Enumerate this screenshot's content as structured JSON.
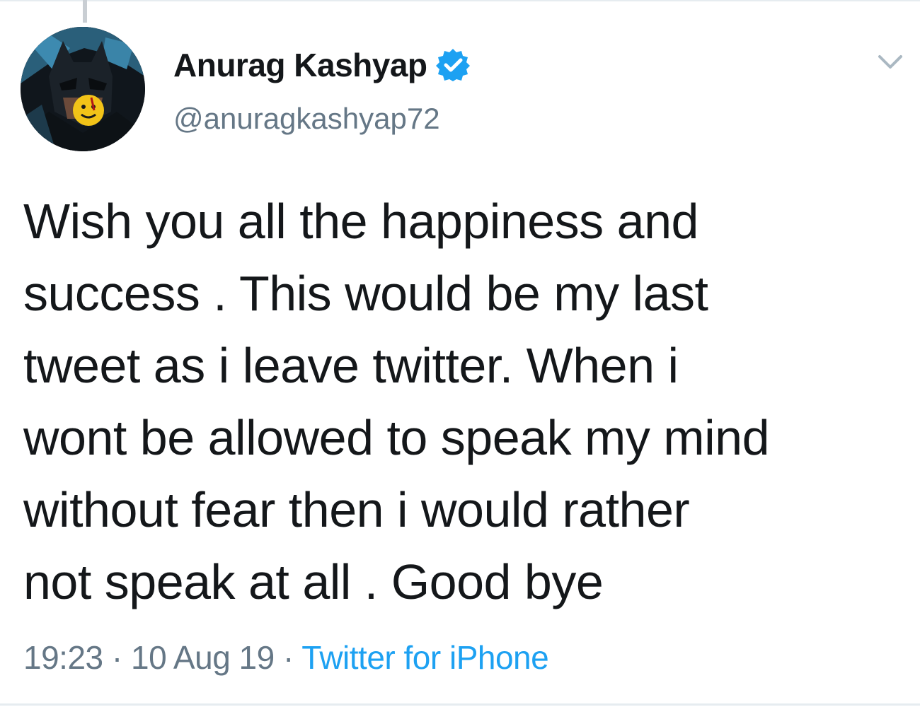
{
  "tweet": {
    "author": {
      "display_name": "Anurag Kashyap",
      "handle": "@anuragkashyap72",
      "verified": true,
      "avatar_icon": "batman-avatar-icon"
    },
    "text_lines": [
      "Wish you all the happiness and",
      "success . This would be my last",
      "tweet as i leave twitter. When i",
      "wont be allowed to speak my mind",
      "without fear then i would rather",
      "not speak at all . Good bye"
    ],
    "time": "19:23",
    "separator": "·",
    "date": "10 Aug 19",
    "source": "Twitter for iPhone"
  },
  "icons": {
    "verified": "verified-badge-icon",
    "menu": "chevron-down-icon"
  },
  "colors": {
    "text": "#14171a",
    "secondary": "#657786",
    "accent": "#1da1f2",
    "divider": "#e6ecf0"
  }
}
